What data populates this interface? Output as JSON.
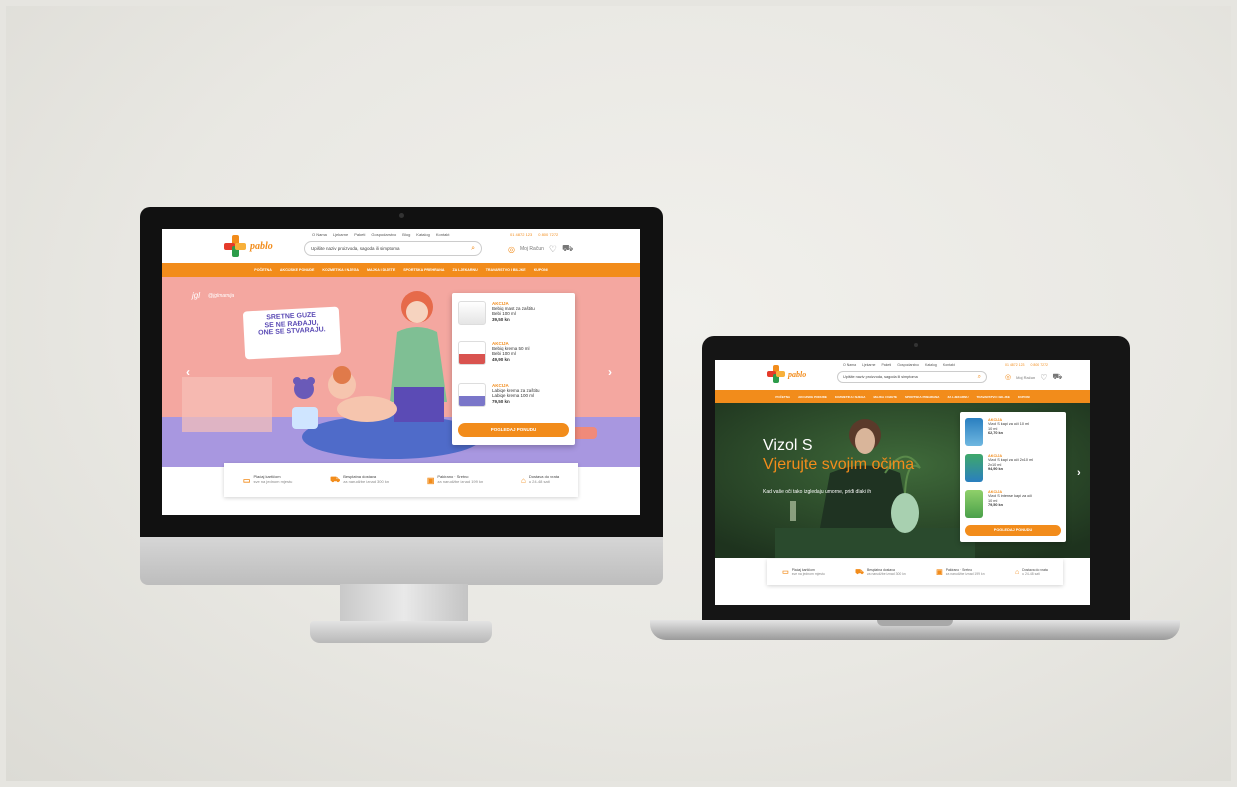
{
  "brand": {
    "logo_text": "pablo",
    "accent": "#f28c1b",
    "cross_colors": [
      "#f28c1b",
      "#e53a2a",
      "#2c9c4a"
    ]
  },
  "desktop": {
    "top_links": [
      "O Nama",
      "Ljekarne",
      "Paketi",
      "Gospodarstvo",
      "Blog",
      "Katalog",
      "Kontakt"
    ],
    "search_placeholder": "Upišite naziv proizvoda, sagoda ili simptoma",
    "search_icon": "search-icon",
    "account_label": "Moj Račun",
    "phones": [
      "01 4872 123",
      "0 800 7272"
    ],
    "nav_items": [
      "POČETNA",
      "AKCIJSKE PONUDE",
      "KOZMETIKA I NJEGA",
      "MAJKA I DIJETE",
      "SPORTSKA PREHRANA",
      "ZA LJEKARNU",
      "TRAVARSTVO I BILJKE",
      "KUPONI"
    ],
    "hero": {
      "brand_logos": [
        "jgl",
        "@jglmamija"
      ],
      "headline": "SRETNE GUZE\nSE NE RAĐAJU,\nONE SE STVARAJU.",
      "bg_color": "#f4a7a0"
    },
    "products": [
      {
        "badge": "AKCIJA",
        "name": "Bebiq mast za zaštitu",
        "size": "Bebi 100 ml",
        "price": "39,50 kn"
      },
      {
        "badge": "AKCIJA",
        "name": "Bebiq krema 50 ml",
        "size": "Bebi 100 ml",
        "price": "49,90 kn"
      },
      {
        "badge": "AKCIJA",
        "name": "Labiqe krema za zaštitu",
        "size": "Labiqe krema 100 ml",
        "price": "79,50 kn"
      }
    ],
    "cta_label": "POGLEDAJ PONUDU",
    "features": [
      {
        "title": "Plaćaj kartičom",
        "sub": "sve na jednom mjestu",
        "icon": "card-icon"
      },
      {
        "title": "Besplatna dostava",
        "sub": "za narudžbe iznad 300 kn",
        "icon": "truck-icon"
      },
      {
        "title": "Pakirano · Sretno",
        "sub": "za narudžbe iznad 199 kn",
        "icon": "gift-icon"
      },
      {
        "title": "Dostava do vrata",
        "sub": "u 24-48 sati",
        "icon": "home-icon"
      }
    ]
  },
  "laptop": {
    "top_links": [
      "O Nama",
      "Ljekarne",
      "Paketi",
      "Gospodarstvo",
      "Katalog",
      "Kontakt"
    ],
    "search_placeholder": "Upišite naziv proizvoda, sagoda ili simptoma",
    "account_label": "Moj Račun",
    "phones": [
      "01 4872 123",
      "0 800 7272"
    ],
    "nav_items": [
      "POČETNA",
      "AKCIJSKE PONUDE",
      "KOZMETIKA I NJEGA",
      "MAJKA I DIJETE",
      "SPORTSKA PREHRANA",
      "ZA LJEKARNU",
      "TRAVARSTVO I BILJKE",
      "KUPONI"
    ],
    "hero": {
      "title": "Vizol S",
      "subtitle": "Vjerujte svojim očima",
      "tagline": "Kad vaše oči tako izgledaju umorne, priđi dlaki ih",
      "bg_color": "#2d4a2c"
    },
    "products": [
      {
        "badge": "AKCIJA",
        "name": "Vizol S kapi za oči 10 ml",
        "size": "10 ml",
        "price": "62,70 kn"
      },
      {
        "badge": "AKCIJA",
        "name": "Vizol S kapi za oči 2x10 ml",
        "size": "2x10 ml",
        "price": "94,90 kn"
      },
      {
        "badge": "AKCIJA",
        "name": "Vizol S intense kapi za oči",
        "size": "10 ml",
        "price": "79,50 kn"
      }
    ],
    "cta_label": "POGLEDAJ PONUDU",
    "features": [
      {
        "title": "Plaćaj kartičom",
        "sub": "sve na jednom mjestu",
        "icon": "card-icon"
      },
      {
        "title": "Besplatna dostava",
        "sub": "za narudžbe iznad 300 kn",
        "icon": "truck-icon"
      },
      {
        "title": "Pakirano · Sretno",
        "sub": "za narudžbe iznad 199 kn",
        "icon": "gift-icon"
      },
      {
        "title": "Dostava do vrata",
        "sub": "u 24-48 sati",
        "icon": "home-icon"
      }
    ]
  }
}
